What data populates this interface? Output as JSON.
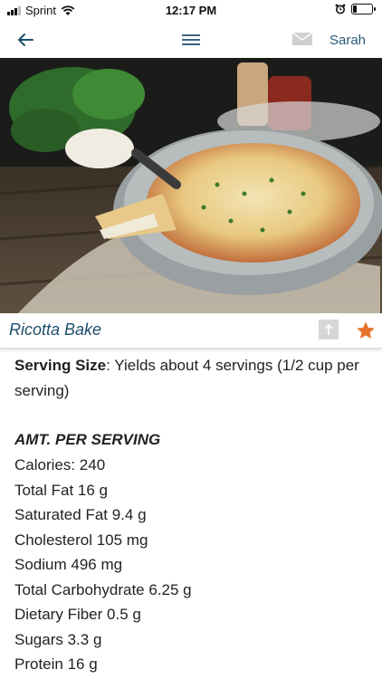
{
  "status_bar": {
    "carrier": "Sprint",
    "time": "12:17 PM",
    "battery_level": 0.2
  },
  "nav": {
    "user_name": "Sarah",
    "icons": [
      "back-arrow-icon",
      "hamburger-menu-icon",
      "mail-icon"
    ]
  },
  "recipe": {
    "title": "Ricotta Bake",
    "icons": [
      "share-icon",
      "star-icon"
    ],
    "favorite_color": "#e8732e"
  },
  "serving": {
    "label": "Serving Size",
    "text": ": Yields about 4 servings (1/2 cup per serving)"
  },
  "nutrition": {
    "heading": "AMT. PER SERVING",
    "items": [
      "Calories:  240",
      "Total Fat 16 g",
      "Saturated Fat 9.4 g",
      "Cholesterol 105 mg",
      "Sodium 496 mg",
      "Total Carbohydrate 6.25 g",
      "Dietary Fiber 0.5 g",
      "Sugars 3.3 g",
      "Protein 16 g"
    ]
  }
}
